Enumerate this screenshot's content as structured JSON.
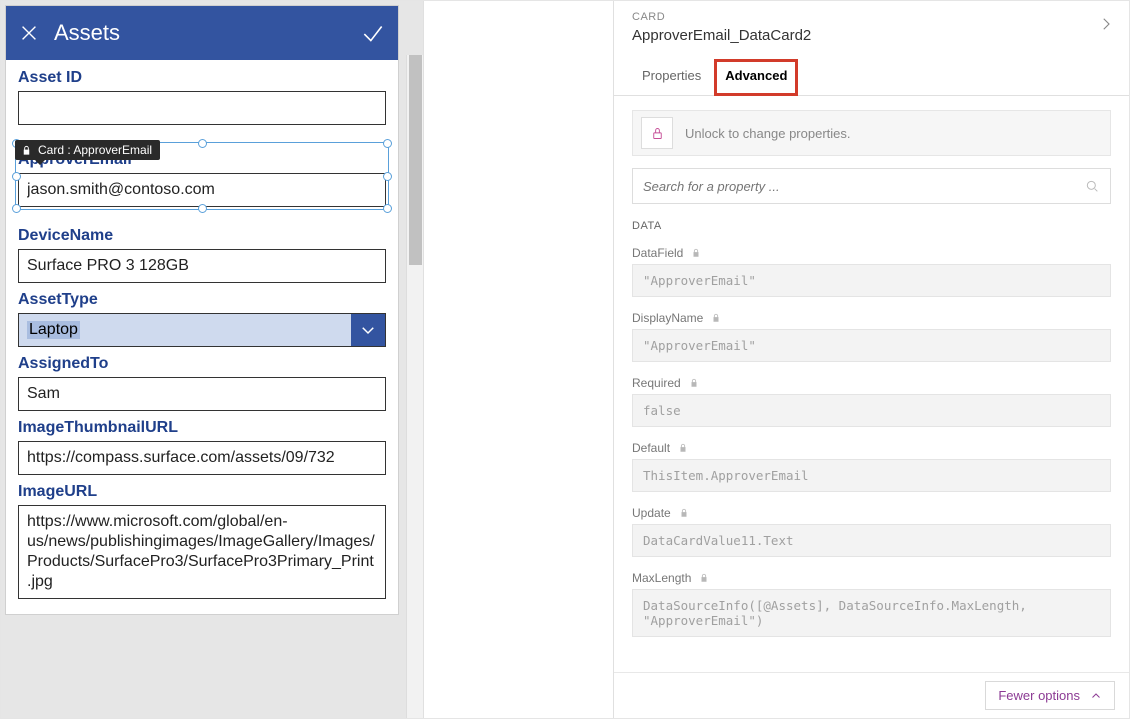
{
  "form": {
    "title": "Assets",
    "selected_badge": "Card : ApproverEmail",
    "cards": {
      "asset_id": {
        "label": "Asset ID",
        "value": ""
      },
      "approver": {
        "label": "ApproverEmail",
        "value": "jason.smith@contoso.com"
      },
      "device": {
        "label": "DeviceName",
        "value": "Surface PRO 3 128GB"
      },
      "asset_type": {
        "label": "AssetType",
        "value": "Laptop"
      },
      "assigned_to": {
        "label": "AssignedTo",
        "value": "Sam"
      },
      "thumb_url": {
        "label": "ImageThumbnailURL",
        "value": "https://compass.surface.com/assets/09/732"
      },
      "image_url": {
        "label": "ImageURL",
        "value": "https://www.microsoft.com/global/en-us/news/publishingimages/ImageGallery/Images/Products/SurfacePro3/SurfacePro3Primary_Print.jpg"
      }
    }
  },
  "panel": {
    "type_label": "CARD",
    "name": "ApproverEmail_DataCard2",
    "tabs": {
      "properties": "Properties",
      "advanced": "Advanced"
    },
    "unlock_text": "Unlock to change properties.",
    "search_placeholder": "Search for a property ...",
    "section_data": "DATA",
    "props": {
      "datafield": {
        "label": "DataField",
        "value": "\"ApproverEmail\""
      },
      "displayname": {
        "label": "DisplayName",
        "value": "\"ApproverEmail\""
      },
      "required": {
        "label": "Required",
        "value": "false"
      },
      "default": {
        "label": "Default",
        "value": "ThisItem.ApproverEmail"
      },
      "update": {
        "label": "Update",
        "value": "DataCardValue11.Text"
      },
      "maxlength": {
        "label": "MaxLength",
        "value": "DataSourceInfo([@Assets], DataSourceInfo.MaxLength, \"ApproverEmail\")"
      }
    },
    "fewer": "Fewer options"
  }
}
